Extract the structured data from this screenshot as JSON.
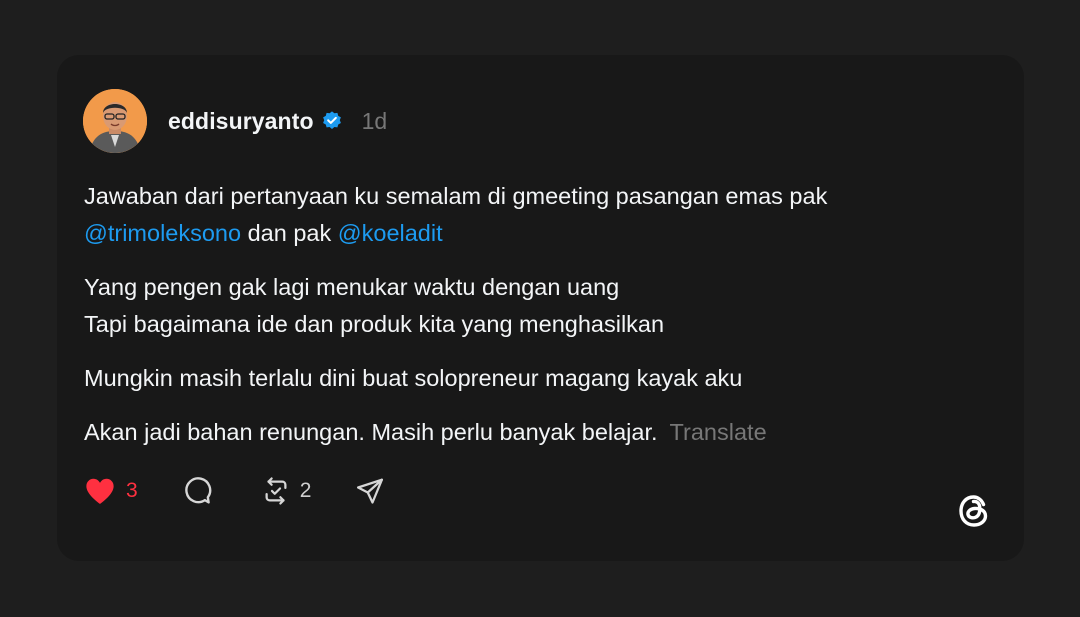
{
  "post": {
    "username": "eddisuryanto",
    "time": "1d",
    "line1": "Jawaban dari pertanyaan ku semalam di gmeeting pasangan emas pak",
    "mention1": "@trimoleksono",
    "connector": " dan pak ",
    "mention2": "@koeladit",
    "para2_line1": "Yang pengen gak lagi menukar waktu dengan uang",
    "para2_line2": "Tapi bagaimana ide dan produk kita yang menghasilkan",
    "para3": "Mungkin masih terlalu dini buat solopreneur magang kayak aku",
    "para4": "Akan jadi bahan renungan. Masih perlu banyak belajar.",
    "translate_label": "Translate"
  },
  "actions": {
    "like_count": "3",
    "repost_count": "2"
  },
  "icons": {
    "avatar": "avatar",
    "verified": "verified-badge-icon",
    "like": "heart-icon",
    "reply": "comment-icon",
    "repost": "repost-icon",
    "share": "send-icon",
    "brand": "threads-logo-icon"
  },
  "colors": {
    "background": "#1e1e1e",
    "card": "#181818",
    "text": "#f3f5f7",
    "muted": "#777777",
    "mention": "#1d9bf0",
    "like": "#ff3040",
    "verified": "#1d9bf0"
  }
}
